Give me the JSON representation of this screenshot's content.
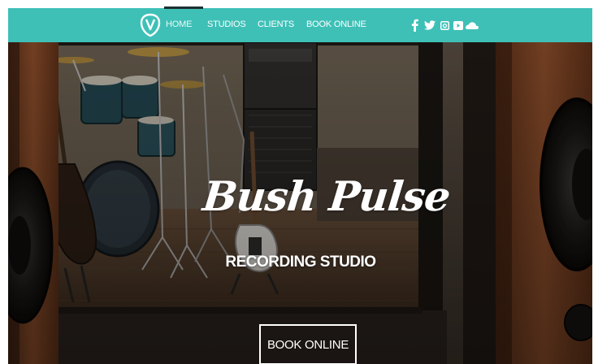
{
  "nav": {
    "logo": "shield-v-logo",
    "items": [
      {
        "label": "HOME",
        "active": true
      },
      {
        "label": "STUDIOS",
        "active": false
      },
      {
        "label": "CLIENTS",
        "active": false
      },
      {
        "label": "BOOK ONLINE",
        "active": false
      }
    ],
    "social": [
      "facebook-icon",
      "twitter-icon",
      "instagram-icon",
      "youtube-icon",
      "soundcloud-icon"
    ]
  },
  "hero": {
    "title": "Bush Pulse",
    "subtitle": "RECORDING STUDIO",
    "cta_label": "BOOK ONLINE"
  },
  "colors": {
    "header": "#3fc0b7",
    "active_indicator": "#1e2f31",
    "text": "#ffffff"
  }
}
